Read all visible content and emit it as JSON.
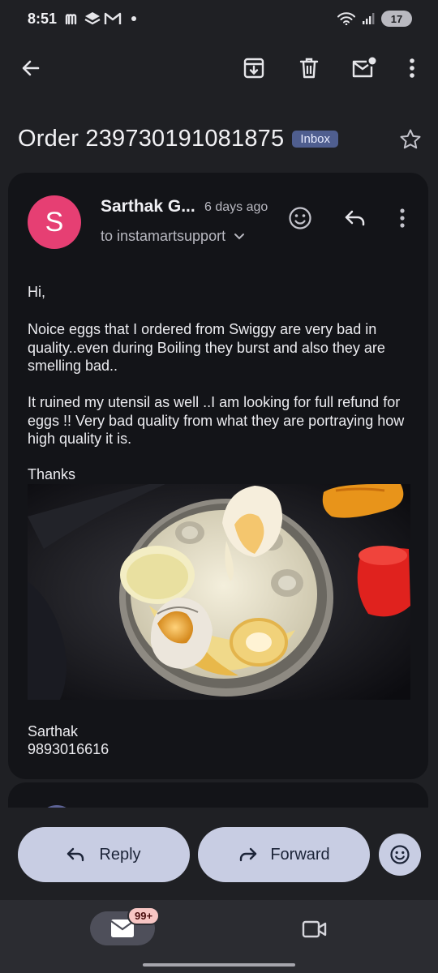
{
  "status_bar": {
    "time": "8:51",
    "battery_level": "17",
    "icons": [
      "m-app-icon",
      "layers-icon",
      "gmail-icon",
      "wifi-icon",
      "signal-icon",
      "battery-icon"
    ]
  },
  "toolbar": {
    "icons": [
      "back-arrow-icon",
      "archive-icon",
      "delete-icon",
      "mark-unread-icon",
      "more-vert-icon"
    ]
  },
  "email": {
    "subject": "Order 239730191081875",
    "label": "Inbox",
    "sender_initial": "S",
    "sender_name": "Sarthak G...",
    "time": "6 days ago",
    "recipient": "to instamartsupport",
    "greeting": "Hi,",
    "paragraph1": "Noice eggs that I ordered from Swiggy are very bad in quality..even during Boiling they burst and also they are smelling bad..",
    "paragraph2": "It ruined my utensil as well ..I am looking for full refund for eggs !! Very bad quality from what they are portraying how high quality it is.",
    "closing": "Thanks",
    "signature_name": "Sarthak",
    "signature_phone": "9893016616",
    "attachment_icon": "egg-boiler-photo"
  },
  "actions": {
    "reply_label": "Reply",
    "forward_label": "Forward"
  },
  "bottom_nav": {
    "mail_badge": "99+"
  },
  "colors": {
    "background": "#1f2024",
    "card": "#131418",
    "avatar": "#e63f73",
    "pill": "#c8cde3",
    "inbox_badge": "#4f5e8f"
  }
}
